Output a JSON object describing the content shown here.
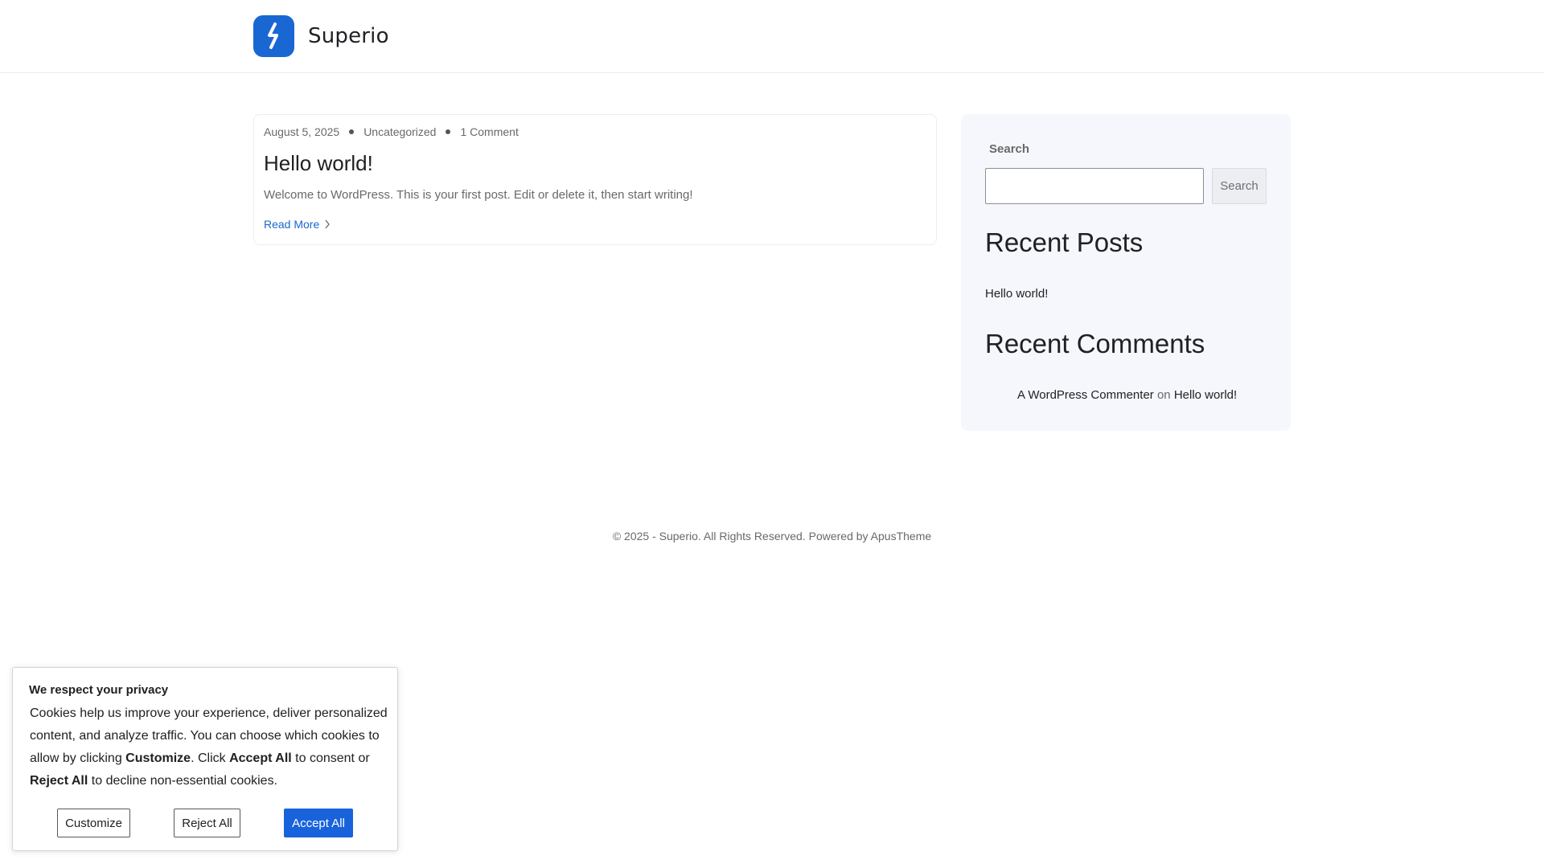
{
  "site": {
    "name": "Superio",
    "brand_color": "#1967d2"
  },
  "post": {
    "date": "August 5, 2025",
    "category": "Uncategorized",
    "comments": "1 Comment",
    "title": "Hello world!",
    "excerpt": "Welcome to WordPress. This is your first post. Edit or delete it, then start writing!",
    "read_more": "Read More"
  },
  "sidebar": {
    "search_label": "Search",
    "search_value": "",
    "search_button": "Search",
    "recent_posts_heading": "Recent Posts",
    "recent_posts": [
      "Hello world!"
    ],
    "recent_comments_heading": "Recent Comments",
    "recent_comment": {
      "author": "A WordPress Commenter",
      "connector": "on",
      "post": "Hello world!"
    }
  },
  "footer": {
    "text": "© 2025 - Superio. All Rights Reserved. Powered by",
    "link": "ApusTheme"
  },
  "cookie": {
    "title": "We respect your privacy",
    "text_1": "Cookies help us improve your experience, deliver personalized content, and analyze traffic. You can choose which cookies to allow by clicking ",
    "bold_customize": "Customize",
    "text_2": ". Click ",
    "bold_accept": "Accept All",
    "text_3": " to consent or ",
    "bold_reject": "Reject All",
    "text_4": " to decline non-essential cookies.",
    "customize_button": "Customize",
    "reject_button": "Reject All",
    "accept_button": "Accept All",
    "accept_color": "#1863dc"
  },
  "icons": {
    "logo": "superio-logo-icon",
    "read_more": "chevron-right-icon"
  }
}
